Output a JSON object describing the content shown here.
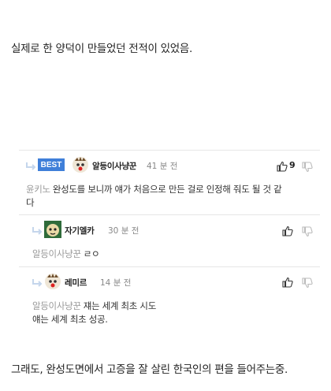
{
  "post": {
    "intro_text": "실제로 한 양덕이 만들었던 전적이 있었음.",
    "outro_text": "그래도, 완성도면에서 고증을 잘 살린 한국인의 편을 들어주는중."
  },
  "comments": [
    {
      "badge": "BEST",
      "nickname": "알등이사냥꾼",
      "time": "41 분 전",
      "upvotes": "9",
      "mention": "윤키노",
      "text_line1": "완성도를 보니까 얘가 처음으로 만든 걸로 인정해 줘도 될 것 같",
      "text_line2": "다"
    },
    {
      "nickname": "자기엘카",
      "time": "30 분 전",
      "mention": "알등이사냥꾼",
      "text_line1": "ㄹㅇ"
    },
    {
      "nickname": "레미르",
      "time": "14 분 전",
      "mention": "알등이사냥꾼",
      "text_line1": "쟤는 세계 최초 시도",
      "text_line2": "얘는 세계 최초 성공."
    }
  ],
  "colors": {
    "best_badge": "#3f7fd9",
    "divider": "#e6e6e6",
    "mention": "#999999",
    "time": "#888888"
  },
  "icons": [
    "reply-arrow-icon",
    "thumbs-up-icon",
    "thumbs-down-icon"
  ]
}
